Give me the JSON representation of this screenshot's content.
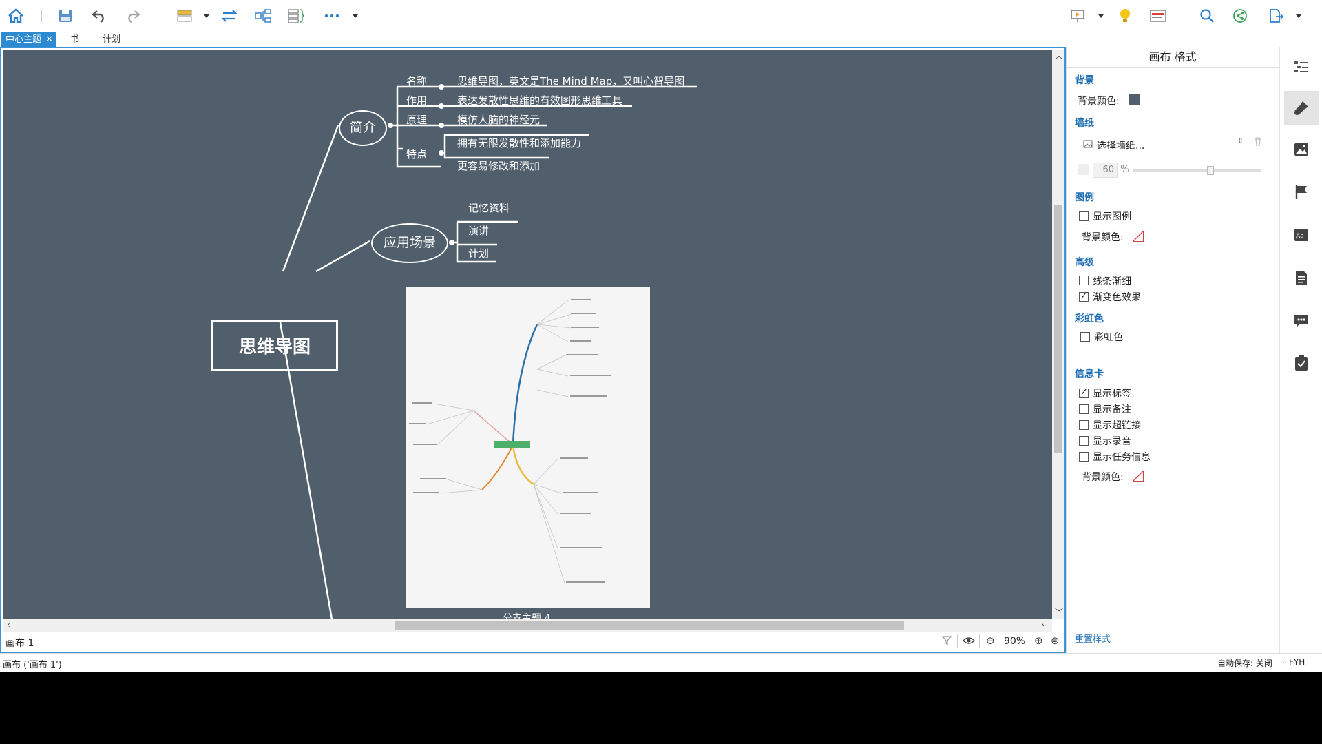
{
  "tabs": [
    {
      "label": "中心主题",
      "active": true
    },
    {
      "label": "书"
    },
    {
      "label": "计划"
    }
  ],
  "toolbar": {
    "left_icons": [
      "home-icon",
      "save-icon",
      "undo-icon",
      "redo-icon",
      "layout-icon",
      "swap-icon",
      "structure-icon",
      "summary-icon",
      "more-icon"
    ],
    "right_icons": [
      "presentation-icon",
      "idea-icon",
      "outline-icon",
      "search-icon",
      "share-icon",
      "export-icon"
    ]
  },
  "mindmap": {
    "central": "思维导图",
    "intro": {
      "label": "简介",
      "items": [
        {
          "key": "名称",
          "value": "思维导图，英文是The Mind Map，又叫心智导图"
        },
        {
          "key": "作用",
          "value": "表达发散性思维的有效图形思维工具"
        },
        {
          "key": "原理",
          "value": "模仿人脑的神经元"
        },
        {
          "key": "特点",
          "values": [
            "拥有无限发散性和添加能力",
            "更容易修改和添加"
          ]
        }
      ]
    },
    "scenarios": {
      "label": "应用场景",
      "items": [
        "记忆资料",
        "演讲",
        "计划"
      ]
    },
    "branch4_label": "分支主题 4"
  },
  "canvas_status": {
    "sheet": "画布 1",
    "zoom": "90%"
  },
  "panel": {
    "title": "画布 格式",
    "background": {
      "section": "背景",
      "color_label": "背景颜色:",
      "color": "#515f6d"
    },
    "wallpaper": {
      "section": "墙纸",
      "select": "选择墙纸...",
      "opacity": "60",
      "unit": "%",
      "opacity_value": 60
    },
    "legend": {
      "section": "图例",
      "show_label": "显示图例",
      "show": false,
      "color_label": "背景颜色:"
    },
    "advanced": {
      "section": "高级",
      "taper_label": "线条渐细",
      "taper": false,
      "gradient_label": "渐变色效果",
      "gradient": true
    },
    "rainbow": {
      "section": "彩虹色",
      "label": "彩虹色",
      "checked": false
    },
    "infocard": {
      "section": "信息卡",
      "options": [
        {
          "label": "显示标签",
          "checked": true
        },
        {
          "label": "显示备注",
          "checked": false
        },
        {
          "label": "显示超链接",
          "checked": false
        },
        {
          "label": "显示录音",
          "checked": false
        },
        {
          "label": "显示任务信息",
          "checked": false
        }
      ],
      "color_label": "背景颜色:"
    },
    "reset": "重置样式"
  },
  "statusbar": {
    "left": "画布 ('画布 1')",
    "autosave": "自动保存: 关闭",
    "user": "FYH"
  },
  "colors": {
    "accent": "#2d8ad0",
    "canvas": "#515f6d",
    "section": "#1f6fb4"
  }
}
